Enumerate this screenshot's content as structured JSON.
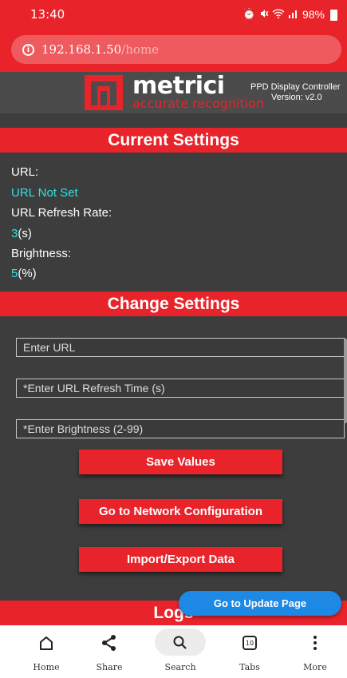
{
  "status_bar": {
    "time": "13:40",
    "battery": "98%",
    "signal_icons": [
      "alarm-icon",
      "mute-icon",
      "wifi-icon",
      "signal-icon"
    ]
  },
  "browser": {
    "url_host": "192.168.1.50",
    "url_path": "/home"
  },
  "header": {
    "brand": "metrici",
    "tagline": "accurate recognition",
    "product": "PPD Display Controller",
    "version": "Version: v2.0"
  },
  "current_settings": {
    "title": "Current Settings",
    "url_label": "URL:",
    "url_value": "URL Not Set",
    "refresh_label": "URL Refresh Rate:",
    "refresh_value": "3",
    "refresh_unit": "(s)",
    "brightness_label": "Brightness:",
    "brightness_value": "5",
    "brightness_unit": "(%)"
  },
  "change_settings": {
    "title": "Change Settings",
    "url_placeholder": "Enter URL",
    "refresh_placeholder": "*Enter URL Refresh Time (s)",
    "brightness_placeholder": "*Enter Brightness (2-99)",
    "save_button": "Save Values",
    "network_button": "Go to Network Configuration",
    "import_button": "Import/Export Data"
  },
  "logs": {
    "title": "Logs"
  },
  "floating": {
    "update_button": "Go to Update Page"
  },
  "bottom_nav": {
    "items": [
      {
        "label": "Home",
        "icon": "home-icon"
      },
      {
        "label": "Share",
        "icon": "share-icon"
      },
      {
        "label": "Search",
        "icon": "search-icon"
      },
      {
        "label": "Tabs",
        "icon": "tabs-icon",
        "count": "10"
      },
      {
        "label": "More",
        "icon": "more-icon"
      }
    ]
  },
  "colors": {
    "accent_red": "#e8232a",
    "page_bg": "#3d3d3d",
    "value_cyan": "#2ee3e3",
    "update_blue": "#1e88e5"
  }
}
